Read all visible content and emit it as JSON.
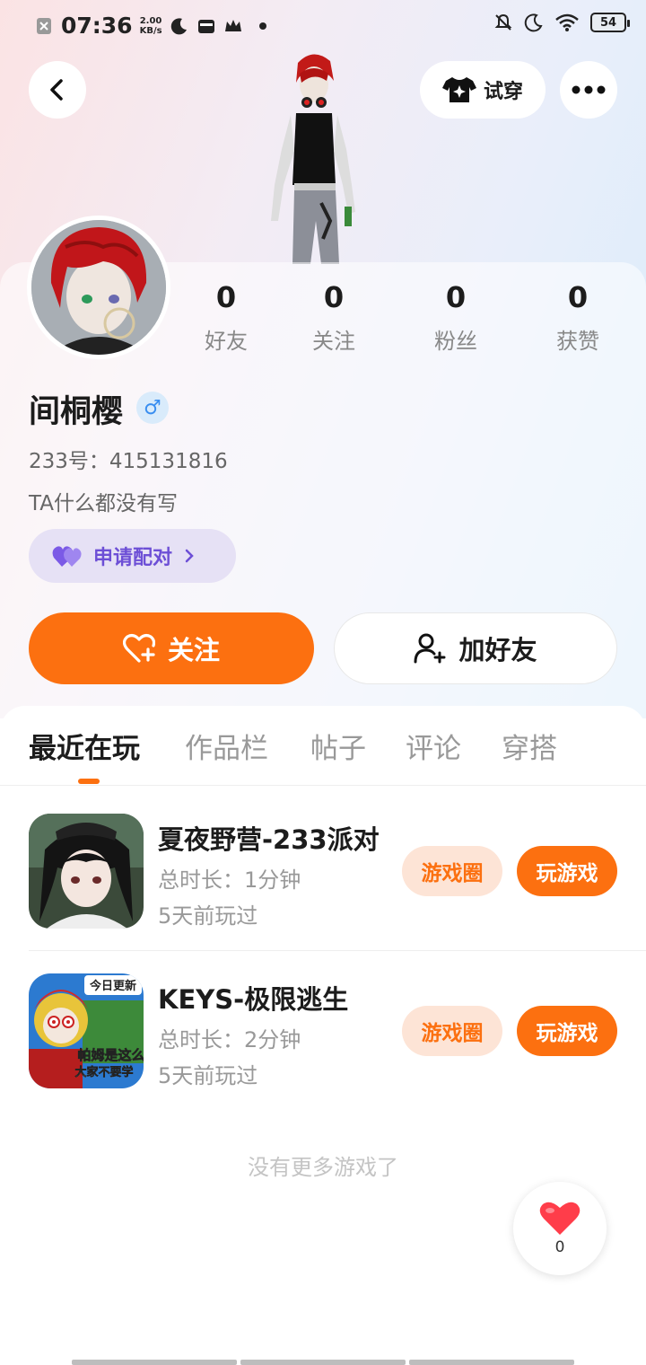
{
  "status_bar": {
    "time": "07:36",
    "net_speed_value": "2.00",
    "net_speed_unit": "KB/s",
    "battery": "54"
  },
  "header": {
    "try_on_label": "试穿"
  },
  "profile": {
    "stats": [
      {
        "value": "0",
        "label": "好友"
      },
      {
        "value": "0",
        "label": "关注"
      },
      {
        "value": "0",
        "label": "粉丝"
      },
      {
        "value": "0",
        "label": "获赞"
      }
    ],
    "username": "间桐樱",
    "gender_symbol": "♂",
    "uid": "233号：415131816",
    "bio": "TA什么都没有写",
    "match_label": "申请配对",
    "follow_label": "关注",
    "add_friend_label": "加好友"
  },
  "tabs": [
    {
      "label": "最近在玩",
      "active": true
    },
    {
      "label": "作品栏"
    },
    {
      "label": "帖子"
    },
    {
      "label": "评论"
    },
    {
      "label": "穿搭"
    }
  ],
  "games": [
    {
      "title": "夏夜野营-233派对",
      "duration": "总时长：1分钟",
      "last_played": "5天前玩过",
      "circle_label": "游戏圈",
      "play_label": "玩游戏"
    },
    {
      "title": "KEYS-极限逃生",
      "duration": "总时长：2分钟",
      "last_played": "5天前玩过",
      "circle_label": "游戏圈",
      "play_label": "玩游戏",
      "icon_text_top": "今日更新",
      "icon_text_mid": "帕姆是这么",
      "icon_text_bot": "大家不要学"
    }
  ],
  "no_more_text": "没有更多游戏了",
  "like_count": "0",
  "colors": {
    "accent": "#fc7010",
    "accent_soft": "#fde4d6",
    "match_purple": "#6d4fd6",
    "gender_blue": "#3a8ef0"
  }
}
